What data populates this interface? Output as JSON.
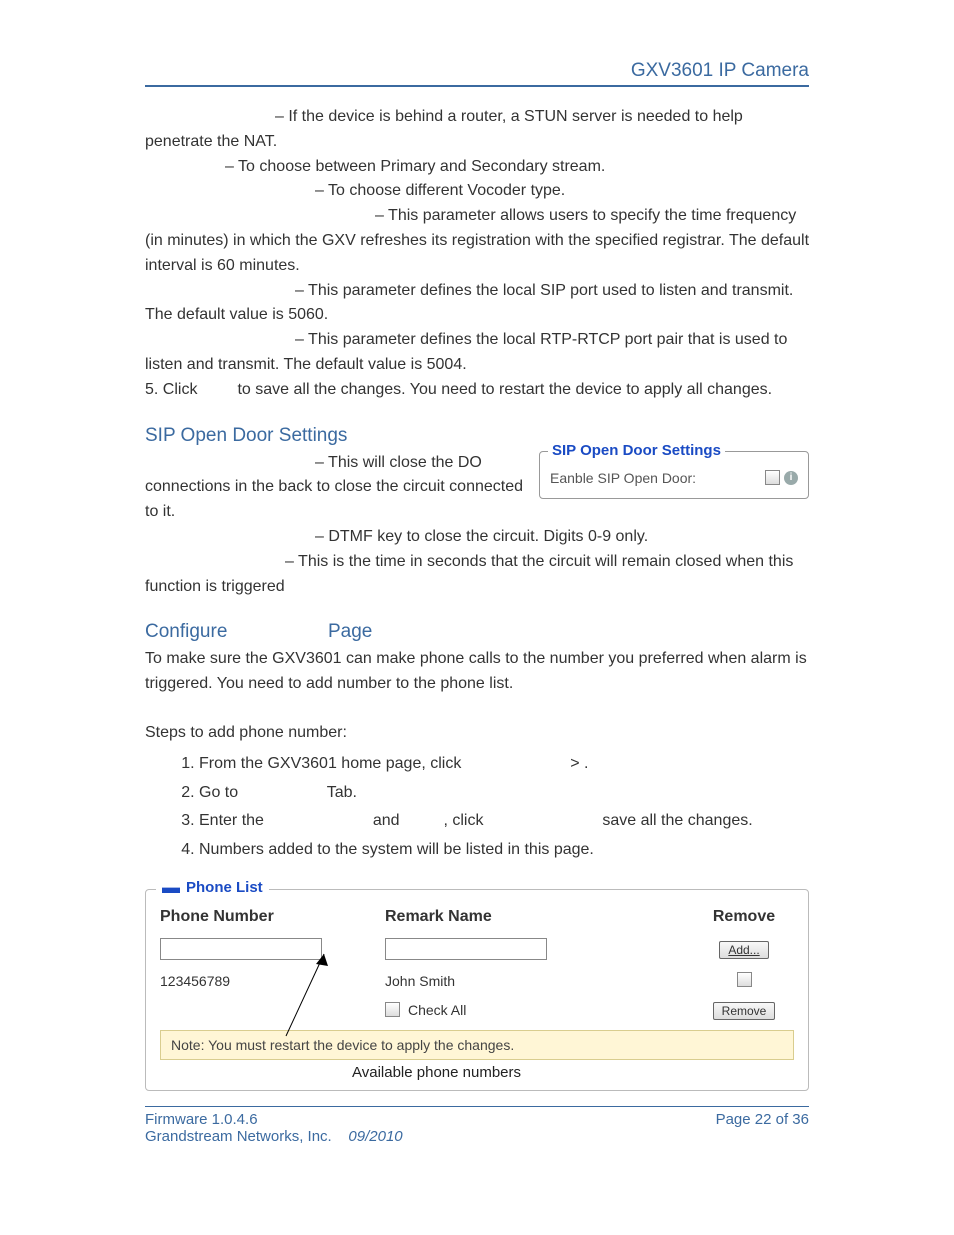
{
  "header": {
    "title": "GXV3601 IP Camera"
  },
  "body": {
    "stun": "– If the device is behind a router, a STUN server is needed to help penetrate the NAT.",
    "stream": "– To choose between Primary and Secondary stream.",
    "vocoder": "– To choose different Vocoder type.",
    "freq": "– This parameter allows users to specify the time frequency (in minutes) in which the GXV refreshes its registration with the specified registrar. The default interval is 60 minutes.",
    "sipport": "– This parameter defines the local SIP port used to listen and transmit. The default value is 5060.",
    "rtpport": "– This parameter defines the local RTP-RTCP port pair that is used to listen and transmit. The default value is 5004.",
    "step5_prefix": "5.    Click",
    "step5_suffix": "to save all the changes. You need to restart the device to apply all changes."
  },
  "sip_section": {
    "title": "SIP Open Door Settings",
    "enable": "– This will close the DO connections in the back to close the circuit connected to it.",
    "dtmf": "– DTMF key to close the circuit. Digits 0-9 only.",
    "delay": "– This is the time in seconds that the circuit will remain closed when this function is triggered",
    "box_legend": "SIP Open Door Settings",
    "box_row": "Eanble SIP Open Door:"
  },
  "configure": {
    "title_a": "Configure",
    "title_b": "Page",
    "intro": "To make sure the GXV3601 can make phone calls to the number you preferred when alarm is triggered. You need to add number to the phone list.",
    "steps_label": "Steps to add phone number:",
    "step1_a": "From the GXV3601 home page, click",
    "step1_b": ">      .",
    "step2_a": "Go to",
    "step2_b": "Tab.",
    "step3_a": "Enter the",
    "step3_b": "and",
    "step3_c": ", click",
    "step3_d": "save all the changes.",
    "step4": "Numbers added to the system will be listed in this page."
  },
  "phone_list": {
    "legend": "Phone List",
    "h1": "Phone Number",
    "h2": "Remark Name",
    "h3": "Remove",
    "add_btn": "Add...",
    "sample_num": "123456789",
    "sample_name": "John Smith",
    "check_all": "Check All",
    "remove_btn": "Remove",
    "note": "Note: You must restart the device to apply the changes.",
    "caption": "Available phone numbers"
  },
  "footer": {
    "fw": "Firmware 1.0.4.6",
    "page": "Page 22 of 36",
    "company": "Grandstream Networks, Inc.",
    "date": "09/2010"
  }
}
